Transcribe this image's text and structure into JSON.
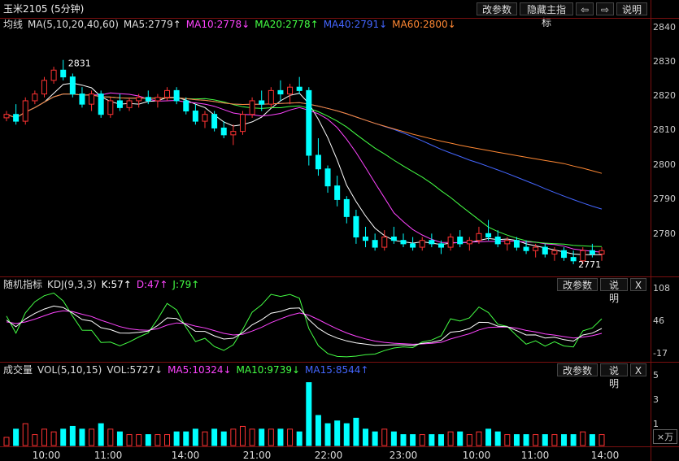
{
  "header": {
    "title": "玉米2105 (5分钟)",
    "buttons": [
      "改参数",
      "隐藏主指标",
      "⇦",
      "⇨",
      "说明"
    ]
  },
  "main_panel": {
    "legend": [
      {
        "text": "均线",
        "color": "#dddddd"
      },
      {
        "text": "MA(5,10,20,40,60)",
        "color": "#dddddd"
      },
      {
        "text": "MA5:2779↑",
        "color": "#dddddd"
      },
      {
        "text": "MA10:2778↓",
        "color": "#ff44ff"
      },
      {
        "text": "MA20:2778↑",
        "color": "#44ff44"
      },
      {
        "text": "MA40:2791↓",
        "color": "#4466ff"
      },
      {
        "text": "MA60:2800↓",
        "color": "#ff8833"
      }
    ],
    "y_ticks": [
      "2840",
      "2830",
      "2820",
      "2810",
      "2800",
      "2790",
      "2780"
    ],
    "annotations": {
      "high": "2831",
      "low": "2771"
    }
  },
  "kdj_panel": {
    "legend": [
      {
        "text": "随机指标",
        "color": "#dddddd"
      },
      {
        "text": "KDJ(9,3,3)",
        "color": "#dddddd"
      },
      {
        "text": "K:57↑",
        "color": "#ffffff"
      },
      {
        "text": "D:47↑",
        "color": "#ff44ff"
      },
      {
        "text": "J:79↑",
        "color": "#44ff44"
      }
    ],
    "y_ticks": [
      "108",
      "46",
      "-17"
    ],
    "buttons": [
      "改参数",
      "说明",
      "X"
    ]
  },
  "vol_panel": {
    "legend": [
      {
        "text": "成交量",
        "color": "#dddddd"
      },
      {
        "text": "VOL(5,10,15)",
        "color": "#dddddd"
      },
      {
        "text": "VOL:5727↓",
        "color": "#dddddd"
      },
      {
        "text": "MA5:10324↓",
        "color": "#ff44ff"
      },
      {
        "text": "MA10:9739↓",
        "color": "#44ff44"
      },
      {
        "text": "MA15:8544↑",
        "color": "#4466ff"
      }
    ],
    "y_ticks": [
      "5",
      "3",
      "1"
    ],
    "unit": "×万",
    "buttons": [
      "改参数",
      "说明",
      "X"
    ]
  },
  "time_axis": [
    "10:00",
    "11:00",
    "14:00",
    "21:00",
    "22:00",
    "23:00",
    "10:00",
    "11:00",
    "14:00"
  ],
  "colors": {
    "up": "#ff3333",
    "down": "#00ffff",
    "grid": "#7a1010",
    "bg": "#000000"
  },
  "chart_data": {
    "type": "candlestick",
    "interval": "5分钟",
    "y_range": [
      2771,
      2840
    ],
    "candles": [
      [
        2814,
        2816,
        2813,
        2815
      ],
      [
        2815,
        2818,
        2812,
        2813
      ],
      [
        2813,
        2820,
        2812,
        2819
      ],
      [
        2819,
        2822,
        2818,
        2821
      ],
      [
        2821,
        2826,
        2820,
        2825
      ],
      [
        2825,
        2829,
        2824,
        2828
      ],
      [
        2828,
        2831,
        2825,
        2826
      ],
      [
        2826,
        2827,
        2820,
        2821
      ],
      [
        2821,
        2823,
        2817,
        2818
      ],
      [
        2818,
        2822,
        2816,
        2821
      ],
      [
        2821,
        2822,
        2814,
        2815
      ],
      [
        2815,
        2820,
        2814,
        2819
      ],
      [
        2819,
        2821,
        2816,
        2817
      ],
      [
        2817,
        2820,
        2816,
        2819
      ],
      [
        2819,
        2821,
        2817,
        2820
      ],
      [
        2820,
        2822,
        2818,
        2819
      ],
      [
        2819,
        2821,
        2817,
        2820
      ],
      [
        2820,
        2823,
        2819,
        2822
      ],
      [
        2822,
        2823,
        2818,
        2819
      ],
      [
        2819,
        2820,
        2815,
        2816
      ],
      [
        2816,
        2818,
        2812,
        2813
      ],
      [
        2813,
        2816,
        2811,
        2815
      ],
      [
        2815,
        2816,
        2810,
        2811
      ],
      [
        2811,
        2813,
        2808,
        2809
      ],
      [
        2809,
        2812,
        2806,
        2810
      ],
      [
        2810,
        2816,
        2809,
        2815
      ],
      [
        2815,
        2820,
        2814,
        2819
      ],
      [
        2819,
        2822,
        2816,
        2818
      ],
      [
        2818,
        2823,
        2817,
        2822
      ],
      [
        2822,
        2825,
        2819,
        2821
      ],
      [
        2821,
        2824,
        2818,
        2823
      ],
      [
        2823,
        2826,
        2821,
        2822
      ],
      [
        2822,
        2823,
        2800,
        2803
      ],
      [
        2803,
        2808,
        2797,
        2799
      ],
      [
        2799,
        2800,
        2792,
        2794
      ],
      [
        2794,
        2797,
        2788,
        2790
      ],
      [
        2790,
        2791,
        2783,
        2785
      ],
      [
        2785,
        2787,
        2777,
        2779
      ],
      [
        2779,
        2782,
        2776,
        2778
      ],
      [
        2778,
        2780,
        2775,
        2776
      ],
      [
        2776,
        2781,
        2775,
        2779
      ],
      [
        2779,
        2782,
        2777,
        2778
      ],
      [
        2778,
        2780,
        2776,
        2777
      ],
      [
        2777,
        2779,
        2775,
        2776
      ],
      [
        2776,
        2779,
        2775,
        2778
      ],
      [
        2778,
        2780,
        2776,
        2777
      ],
      [
        2777,
        2778,
        2774,
        2776
      ],
      [
        2776,
        2780,
        2775,
        2779
      ],
      [
        2779,
        2781,
        2776,
        2777
      ],
      [
        2777,
        2779,
        2775,
        2778
      ],
      [
        2778,
        2782,
        2777,
        2780
      ],
      [
        2780,
        2784,
        2778,
        2779
      ],
      [
        2779,
        2781,
        2776,
        2777
      ],
      [
        2777,
        2779,
        2775,
        2778
      ],
      [
        2778,
        2779,
        2775,
        2776
      ],
      [
        2776,
        2778,
        2774,
        2775
      ],
      [
        2775,
        2777,
        2773,
        2776
      ],
      [
        2776,
        2777,
        2773,
        2774
      ],
      [
        2774,
        2776,
        2772,
        2775
      ],
      [
        2775,
        2776,
        2772,
        2773
      ],
      [
        2773,
        2775,
        2771,
        2772
      ],
      [
        2772,
        2776,
        2771,
        2775
      ],
      [
        2775,
        2777,
        2773,
        2774
      ],
      [
        2774,
        2776,
        2772,
        2775
      ]
    ]
  }
}
